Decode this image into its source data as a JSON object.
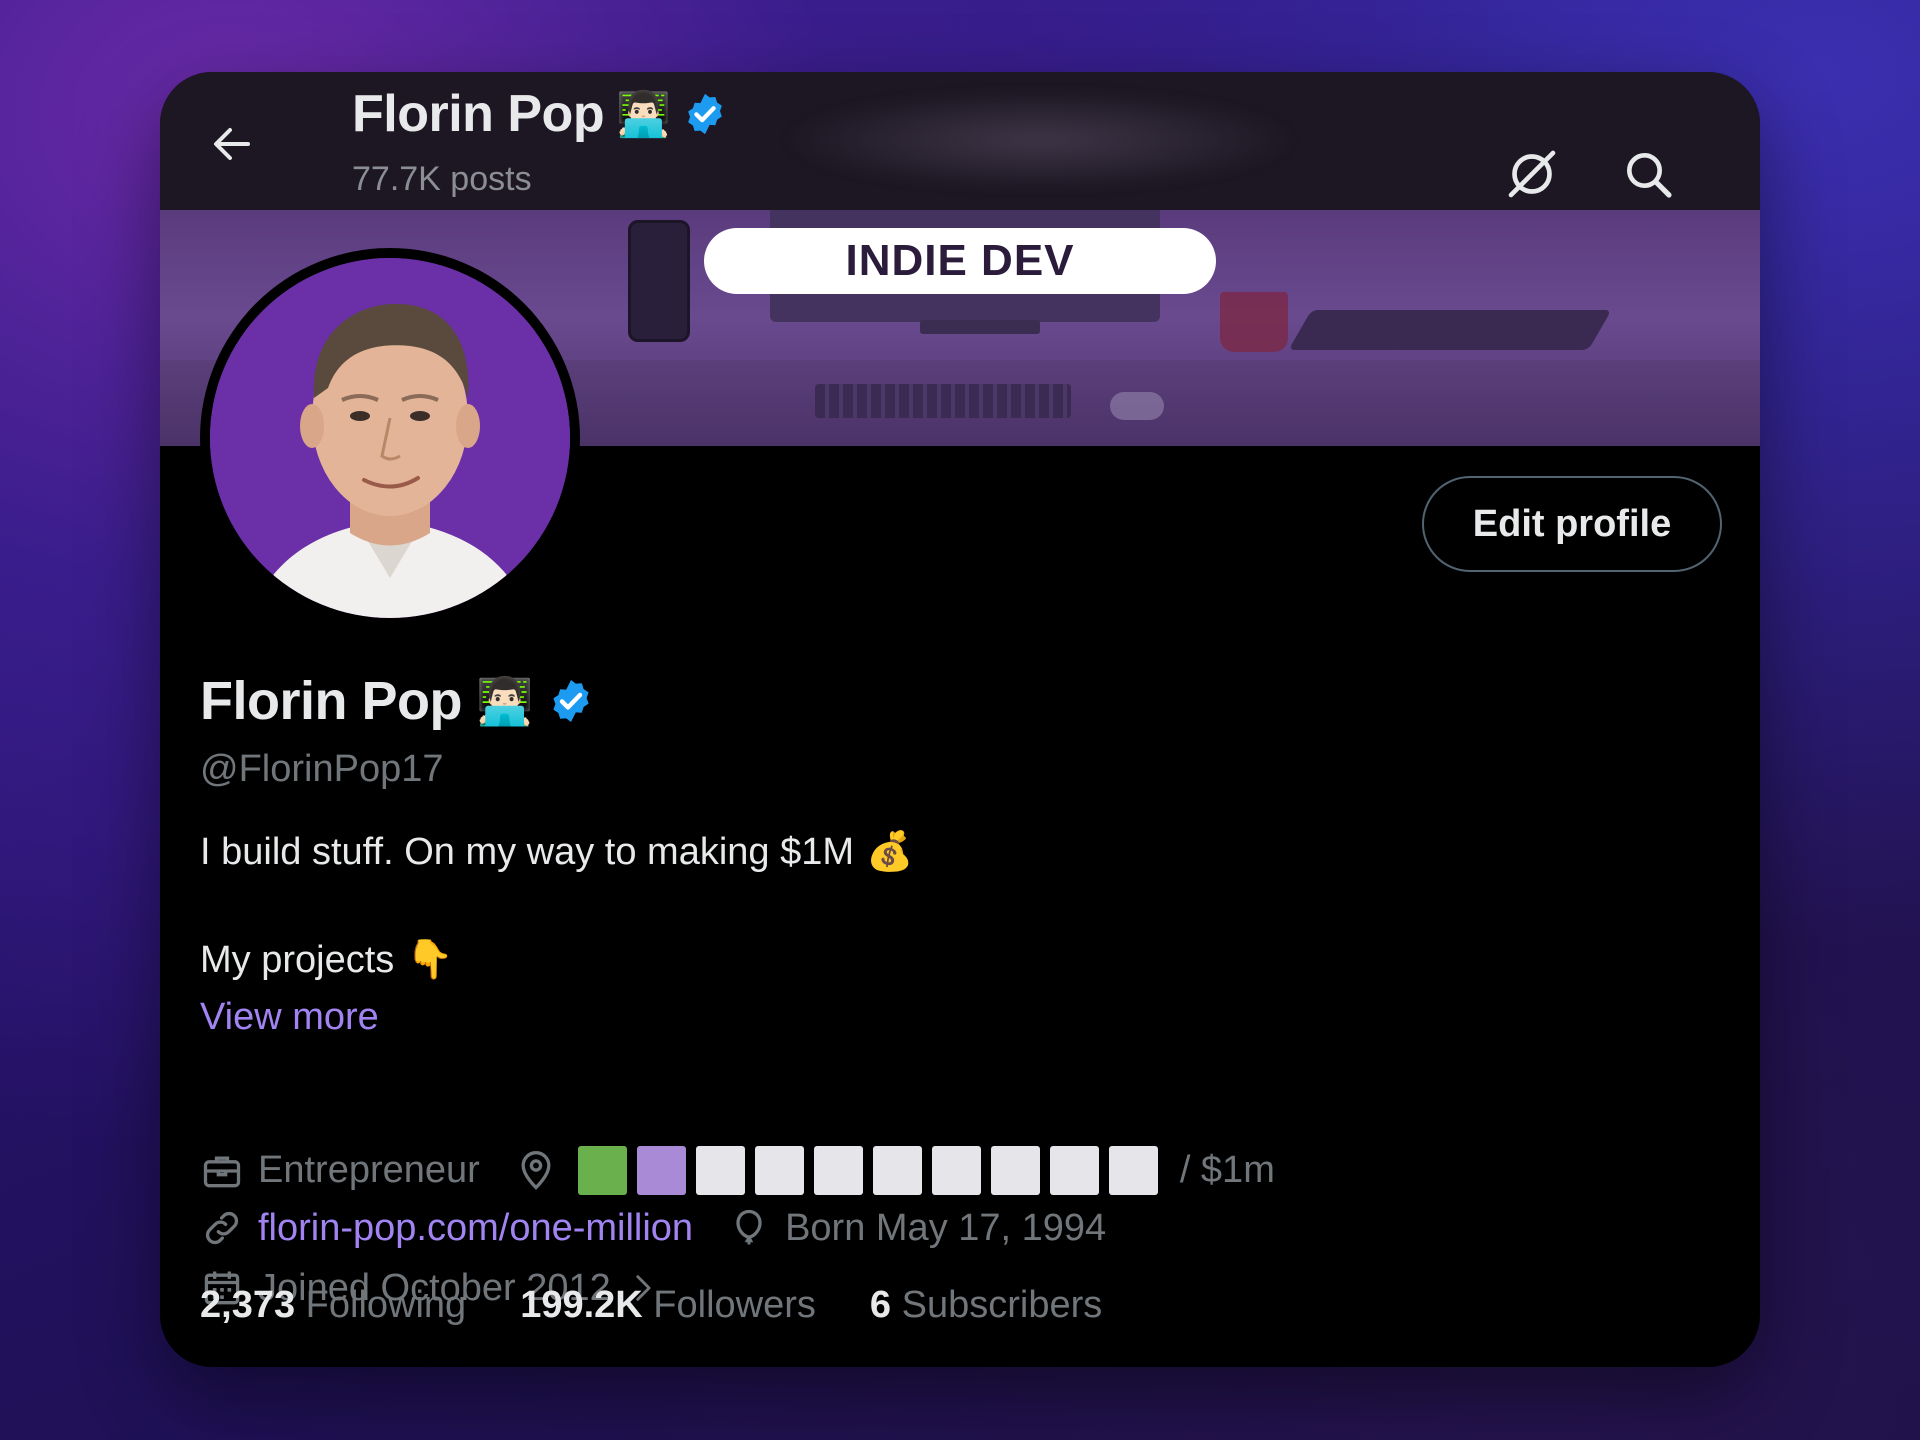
{
  "header": {
    "name": "Florin Pop",
    "posts": "77.7K posts",
    "emoji": "👨🏻‍💻"
  },
  "banner": {
    "pill_text": "INDIE DEV"
  },
  "profile": {
    "name": "Florin Pop",
    "emoji": "👨🏻‍💻",
    "handle": "@FlorinPop17",
    "edit_label": "Edit profile",
    "bio_line1": "I build stuff. On my way to making $1M",
    "bio_emoji1": "💰",
    "bio_line2": "My projects",
    "bio_emoji2": "👇",
    "view_more": "View more"
  },
  "meta": {
    "profession": "Entrepreneur",
    "progress_suffix": "/ $1m",
    "progress_cells": [
      "#6ab04c",
      "#a98ad6",
      "#e6e6ea",
      "#e6e6ea",
      "#e6e6ea",
      "#e6e6ea",
      "#e6e6ea",
      "#e6e6ea",
      "#e6e6ea",
      "#e6e6ea"
    ],
    "website": "florin-pop.com/one-million",
    "born": "Born May 17, 1994",
    "joined": "Joined October 2012"
  },
  "stats": {
    "following_count": "2,373",
    "following_label": "Following",
    "followers_count": "199.2K",
    "followers_label": "Followers",
    "subscribers_count": "6",
    "subscribers_label": "Subscribers"
  },
  "colors": {
    "verified": "#1d9bf0",
    "link": "#a184f2",
    "accent_banner": "#6a4a8f"
  },
  "icons": [
    "back-arrow-icon",
    "grok-icon",
    "search-icon",
    "verified-badge-icon",
    "briefcase-icon",
    "location-icon",
    "link-icon",
    "birthday-balloon-icon",
    "calendar-icon",
    "chevron-right-icon"
  ]
}
